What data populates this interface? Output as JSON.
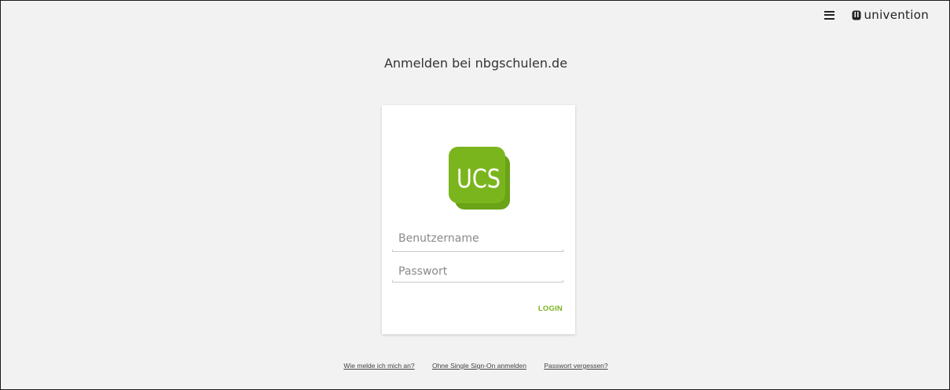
{
  "header": {
    "menu_icon": "hamburger-menu-icon",
    "brand_name": "univention",
    "brand_icon": "univention-logo-icon"
  },
  "page": {
    "title": "Anmelden bei nbgschulen.de"
  },
  "login_card": {
    "logo_text": "UCS",
    "logo_color": "#7ab51d",
    "username_placeholder": "Benutzername",
    "username_value": "",
    "password_placeholder": "Passwort",
    "password_value": "",
    "login_label": "LOGIN"
  },
  "footer": {
    "links": [
      "Wie melde ich mich an?",
      "Ohne Single Sign-On anmelden",
      "Passwort vergessen?"
    ]
  },
  "colors": {
    "accent": "#7ab51d",
    "background": "#f2f2f2",
    "card": "#ffffff"
  }
}
